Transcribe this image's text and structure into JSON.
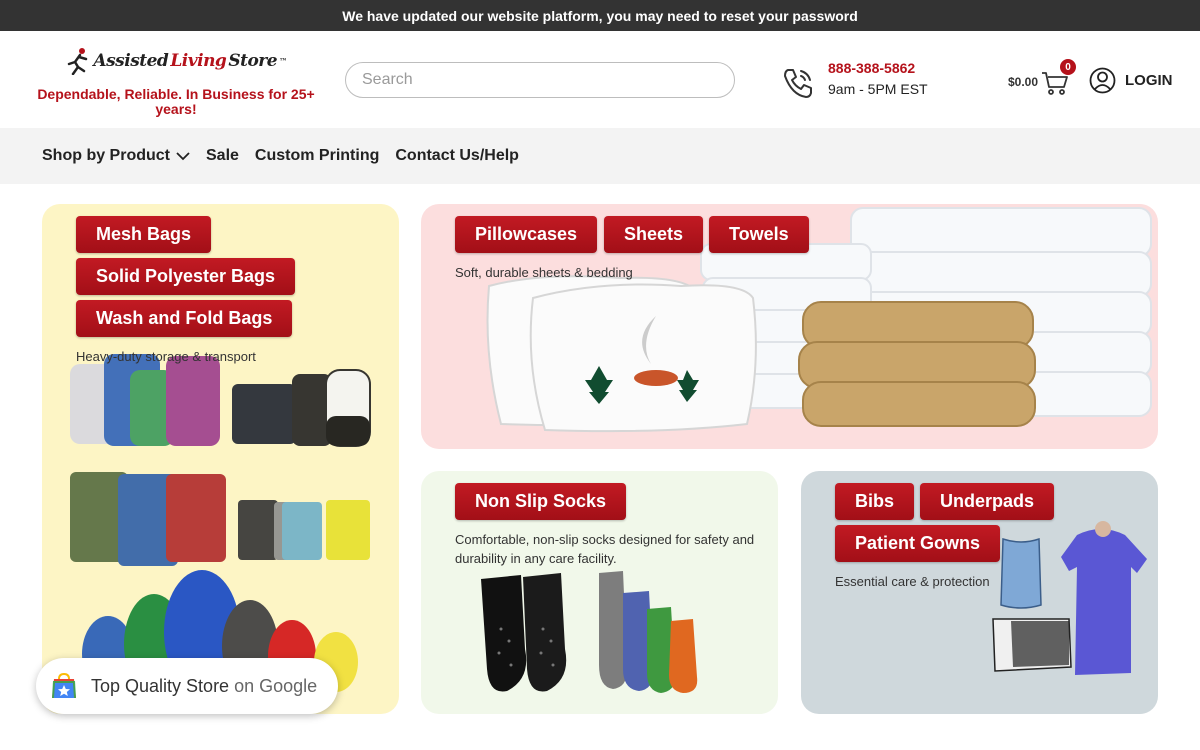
{
  "announcement": "We have updated our website platform, you may need to reset your password",
  "logo": {
    "part1": "Assisted",
    "part2": "Living",
    "part3": "Store",
    "tm": "™"
  },
  "tagline": "Dependable, Reliable. In Business for 25+ years!",
  "search": {
    "placeholder": "Search",
    "value": ""
  },
  "phone": {
    "number": "888-388-5862",
    "hours": "9am - 5PM EST"
  },
  "cart": {
    "total": "$0.00",
    "count": "0"
  },
  "login_label": "LOGIN",
  "nav": [
    {
      "label": "Shop by Product"
    },
    {
      "label": "Sale"
    },
    {
      "label": "Custom Printing"
    },
    {
      "label": "Contact Us/Help"
    }
  ],
  "cards": {
    "laundry": {
      "buttons": [
        "Mesh Bags",
        "Solid Polyester Bags",
        "Wash and Fold Bags"
      ],
      "desc": "Heavy-duty storage & transport"
    },
    "linens": {
      "buttons": [
        "Pillowcases",
        "Sheets",
        "Towels"
      ],
      "desc": "Soft, durable sheets & bedding"
    },
    "socks": {
      "buttons": [
        "Non Slip Socks"
      ],
      "desc": "Comfortable, non-slip socks designed for safety and durability in any care facility."
    },
    "care": {
      "buttons": [
        "Bibs",
        "Underpads",
        "Patient Gowns"
      ],
      "desc": "Essential care & protection"
    }
  },
  "google_badge": {
    "label": "Top Quality Store",
    "suffix": "on Google"
  },
  "colors": {
    "brand_red": "#b5121b",
    "announce_bg": "#333333",
    "nav_bg": "#f3f3f3"
  },
  "icons": [
    "runner-logo-icon",
    "phone-icon",
    "cart-icon",
    "user-icon",
    "chevron-down-icon",
    "google-shopping-icon"
  ]
}
